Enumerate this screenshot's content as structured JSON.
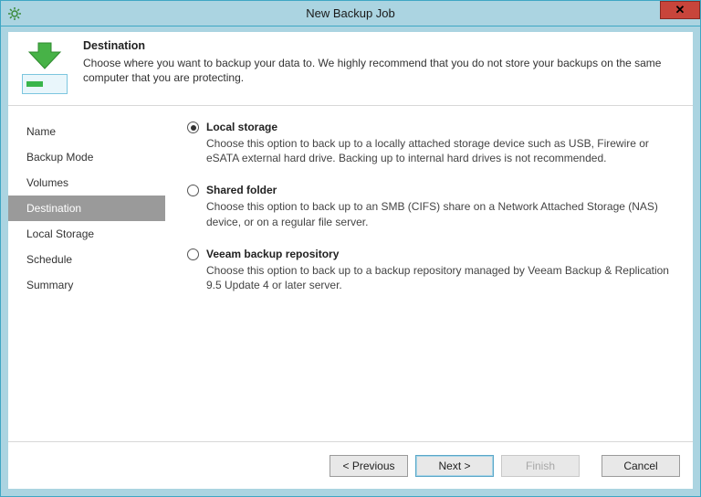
{
  "window": {
    "title": "New Backup Job"
  },
  "header": {
    "title": "Destination",
    "desc": "Choose where you want to backup your data to. We highly recommend that you do not store your backups on the same computer that you are protecting."
  },
  "sidebar": {
    "items": [
      {
        "label": "Name",
        "active": false
      },
      {
        "label": "Backup Mode",
        "active": false
      },
      {
        "label": "Volumes",
        "active": false
      },
      {
        "label": "Destination",
        "active": true
      },
      {
        "label": "Local Storage",
        "active": false
      },
      {
        "label": "Schedule",
        "active": false
      },
      {
        "label": "Summary",
        "active": false
      }
    ]
  },
  "options": [
    {
      "title": "Local storage",
      "desc": "Choose this option to back up to a locally attached storage device such as USB, Firewire or eSATA external hard drive. Backing up to internal hard drives is not recommended.",
      "selected": true
    },
    {
      "title": "Shared folder",
      "desc": "Choose this option to back up to an SMB (CIFS) share on a Network Attached Storage (NAS) device, or on a regular file server.",
      "selected": false
    },
    {
      "title": "Veeam backup repository",
      "desc": "Choose this option to back up to a backup repository managed by Veeam Backup & Replication 9.5 Update 4 or later server.",
      "selected": false
    }
  ],
  "buttons": {
    "previous": "< Previous",
    "next": "Next >",
    "finish": "Finish",
    "cancel": "Cancel"
  }
}
